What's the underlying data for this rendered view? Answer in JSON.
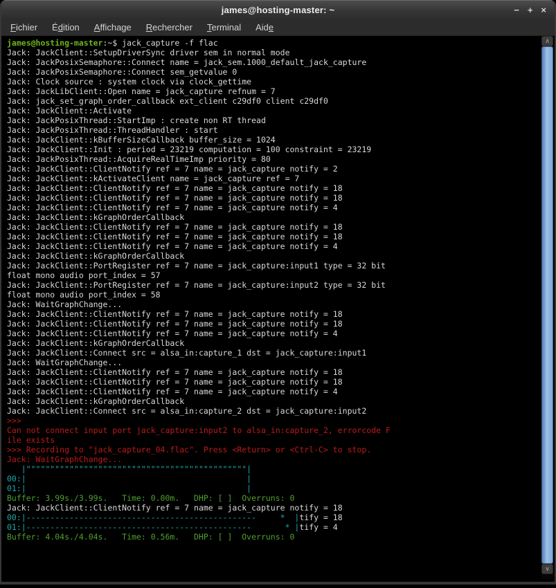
{
  "window": {
    "title": "james@hosting-master: ~",
    "controls": {
      "minimize": "−",
      "maximize": "+",
      "close": "×"
    }
  },
  "menubar": {
    "items": [
      {
        "name": "fichier",
        "pre": "",
        "key": "F",
        "post": "ichier"
      },
      {
        "name": "edition",
        "pre": "É",
        "key": "d",
        "post": "ition"
      },
      {
        "name": "affichage",
        "pre": "",
        "key": "A",
        "post": "ffichage"
      },
      {
        "name": "rechercher",
        "pre": "",
        "key": "R",
        "post": "echercher"
      },
      {
        "name": "terminal",
        "pre": "",
        "key": "T",
        "post": "erminal"
      },
      {
        "name": "aide",
        "pre": "Aid",
        "key": "e",
        "post": ""
      }
    ]
  },
  "scrollbar": {
    "up_glyph": "∧",
    "down_glyph": "∨"
  },
  "colors": {
    "fg": "#d9d9d9",
    "prompt": "#6eb41e",
    "red": "#bd1a1a",
    "green": "#4ea12c",
    "cyan": "#1fa8a8"
  },
  "terminal": {
    "lines": [
      [
        [
          "prompt",
          "james@hosting-master"
        ],
        [
          "fg",
          ":~$ jack_capture -f flac"
        ]
      ],
      [
        [
          "fg",
          "Jack: JackClient::SetupDriverSync driver sem in normal mode"
        ]
      ],
      [
        [
          "fg",
          "Jack: JackPosixSemaphore::Connect name = jack_sem.1000_default_jack_capture"
        ]
      ],
      [
        [
          "fg",
          "Jack: JackPosixSemaphore::Connect sem_getvalue 0"
        ]
      ],
      [
        [
          "fg",
          "Jack: Clock source : system clock via clock_gettime"
        ]
      ],
      [
        [
          "fg",
          "Jack: JackLibClient::Open name = jack_capture refnum = 7"
        ]
      ],
      [
        [
          "fg",
          "Jack: jack_set_graph_order_callback ext_client c29df0 client c29df0"
        ]
      ],
      [
        [
          "fg",
          "Jack: JackClient::Activate"
        ]
      ],
      [
        [
          "fg",
          "Jack: JackPosixThread::StartImp : create non RT thread"
        ]
      ],
      [
        [
          "fg",
          "Jack: JackPosixThread::ThreadHandler : start"
        ]
      ],
      [
        [
          "fg",
          "Jack: JackClient::kBufferSizeCallback buffer_size = 1024"
        ]
      ],
      [
        [
          "fg",
          "Jack: JackClient::Init : period = 23219 computation = 100 constraint = 23219"
        ]
      ],
      [
        [
          "fg",
          "Jack: JackPosixThread::AcquireRealTimeImp priority = 80"
        ]
      ],
      [
        [
          "fg",
          "Jack: JackClient::ClientNotify ref = 7 name = jack_capture notify = 2"
        ]
      ],
      [
        [
          "fg",
          "Jack: JackClient::kActivateClient name = jack_capture ref = 7"
        ]
      ],
      [
        [
          "fg",
          "Jack: JackClient::ClientNotify ref = 7 name = jack_capture notify = 18"
        ]
      ],
      [
        [
          "fg",
          "Jack: JackClient::ClientNotify ref = 7 name = jack_capture notify = 18"
        ]
      ],
      [
        [
          "fg",
          "Jack: JackClient::ClientNotify ref = 7 name = jack_capture notify = 4"
        ]
      ],
      [
        [
          "fg",
          "Jack: JackClient::kGraphOrderCallback"
        ]
      ],
      [
        [
          "fg",
          "Jack: JackClient::ClientNotify ref = 7 name = jack_capture notify = 18"
        ]
      ],
      [
        [
          "fg",
          "Jack: JackClient::ClientNotify ref = 7 name = jack_capture notify = 18"
        ]
      ],
      [
        [
          "fg",
          "Jack: JackClient::ClientNotify ref = 7 name = jack_capture notify = 4"
        ]
      ],
      [
        [
          "fg",
          "Jack: JackClient::kGraphOrderCallback"
        ]
      ],
      [
        [
          "fg",
          "Jack: JackClient::PortRegister ref = 7 name = jack_capture:input1 type = 32 bit"
        ]
      ],
      [
        [
          "fg",
          "float mono audio port_index = 57"
        ]
      ],
      [
        [
          "fg",
          "Jack: JackClient::PortRegister ref = 7 name = jack_capture:input2 type = 32 bit"
        ]
      ],
      [
        [
          "fg",
          "float mono audio port_index = 58"
        ]
      ],
      [
        [
          "fg",
          "Jack: WaitGraphChange..."
        ]
      ],
      [
        [
          "fg",
          "Jack: JackClient::ClientNotify ref = 7 name = jack_capture notify = 18"
        ]
      ],
      [
        [
          "fg",
          "Jack: JackClient::ClientNotify ref = 7 name = jack_capture notify = 18"
        ]
      ],
      [
        [
          "fg",
          "Jack: JackClient::ClientNotify ref = 7 name = jack_capture notify = 4"
        ]
      ],
      [
        [
          "fg",
          "Jack: JackClient::kGraphOrderCallback"
        ]
      ],
      [
        [
          "fg",
          "Jack: JackClient::Connect src = alsa_in:capture_1 dst = jack_capture:input1"
        ]
      ],
      [
        [
          "fg",
          "Jack: WaitGraphChange..."
        ]
      ],
      [
        [
          "fg",
          "Jack: JackClient::ClientNotify ref = 7 name = jack_capture notify = 18"
        ]
      ],
      [
        [
          "fg",
          "Jack: JackClient::ClientNotify ref = 7 name = jack_capture notify = 18"
        ]
      ],
      [
        [
          "fg",
          "Jack: JackClient::ClientNotify ref = 7 name = jack_capture notify = 4"
        ]
      ],
      [
        [
          "fg",
          "Jack: JackClient::kGraphOrderCallback"
        ]
      ],
      [
        [
          "fg",
          "Jack: JackClient::Connect src = alsa_in:capture_2 dst = jack_capture:input2"
        ]
      ],
      [
        [
          "red",
          ">>>"
        ]
      ],
      [
        [
          "red",
          "Can not connect input port jack_capture:input2 to alsa_in:capture_2, errorcode F"
        ]
      ],
      [
        [
          "red",
          "ile exists"
        ]
      ],
      [
        [
          "red",
          ">>> Recording to \"jack_capture_04.flac\". Press <Return> or <Ctrl-C> to stop."
        ]
      ],
      [
        [
          "red",
          "Jack: WaitGraphChange..."
        ]
      ],
      [
        [
          "cyan",
          "   |\"\"\"\"\"\"\"\"\"\"\"\"\"\"\"\"\"\"\"\"\"\"\"\"\"\"\"\"\"\"\"\"\"\"\"\"\"\"\"\"\"\"\"\"\"\"|"
        ]
      ],
      [
        [
          "cyan",
          "00:|                                              |"
        ]
      ],
      [
        [
          "cyan",
          "01:|                                              |"
        ]
      ],
      [
        [
          "green",
          "Buffer: 3.99s./3.99s.   Time: 0.00m.   DHP: [ ]  Overruns: 0"
        ]
      ],
      [
        [
          "fg",
          "Jack: JackClient::ClientNotify ref = 7 name = jack_capture notify = 18"
        ]
      ],
      [
        [
          "cyan",
          "00:|------------------------------------------------     *  |"
        ],
        [
          "fg",
          "tify = 18"
        ]
      ],
      [
        [
          "cyan",
          "01:|-----------------------------------------------       * |"
        ],
        [
          "fg",
          "tify = 4"
        ]
      ],
      [
        [
          "green",
          "Buffer: 4.04s./4.04s.   Time: 0.56m.   DHP: [ ]  Overruns: 0"
        ]
      ]
    ]
  }
}
